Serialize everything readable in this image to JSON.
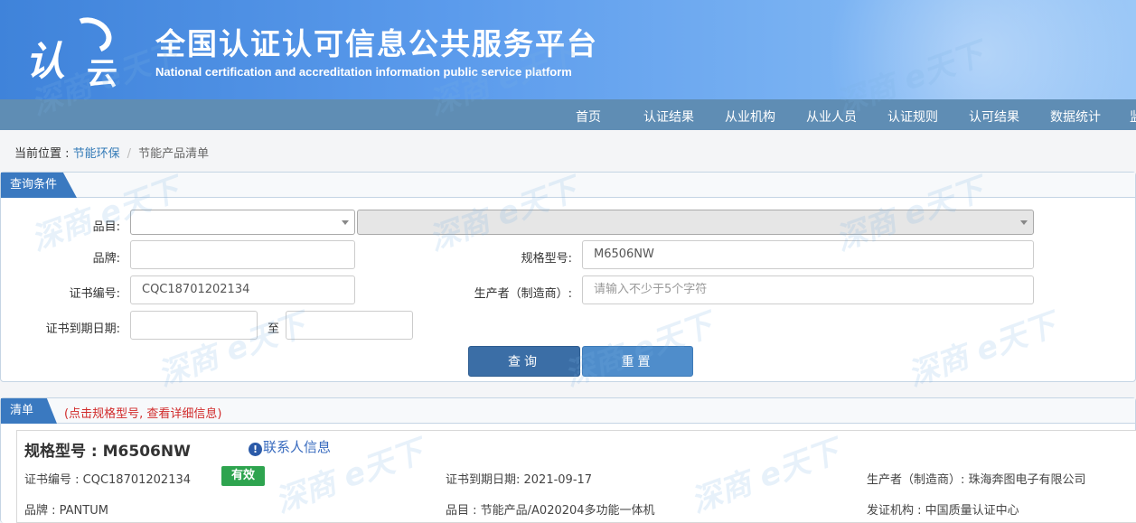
{
  "header": {
    "logo_text_1": "认",
    "logo_text_2": "云",
    "title": "全国认证认可信息公共服务平台",
    "subtitle": "National certification and accreditation information public service platform"
  },
  "nav": {
    "items": [
      "首页",
      "认证结果",
      "从业机构",
      "从业人员",
      "认证规则",
      "认可结果",
      "数据统计",
      "监"
    ]
  },
  "breadcrumb": {
    "prefix": "当前位置 : ",
    "section": "节能环保",
    "separator": "/",
    "current": "节能产品清单"
  },
  "query_panel": {
    "tab": "查询条件",
    "category_label": "品目:",
    "brand_label": "品牌:",
    "brand_value": "",
    "model_label": "规格型号:",
    "model_value": "M6506NW",
    "cert_no_label": "证书编号:",
    "cert_no_value": "CQC18701202134",
    "maker_label": "生产者（制造商）:",
    "maker_placeholder": "请输入不少于5个字符",
    "expiry_label": "证书到期日期:",
    "expiry_to": "至",
    "query_button": "查询",
    "reset_button": "重置"
  },
  "list_panel": {
    "tab": "清单",
    "note": "(点击规格型号, 查看详细信息)"
  },
  "result": {
    "model": "规格型号 : M6506NW",
    "contact_icon": "info-icon",
    "contact": "联系人信息",
    "cert_no": "证书编号 : CQC18701202134",
    "status": "有效",
    "expiry": "证书到期日期: 2021-09-17",
    "maker": "生产者（制造商）: 珠海奔图电子有限公司",
    "brand": "品牌 : PANTUM",
    "category": "品目 : 节能产品/A020204多功能一体机",
    "issuer": "发证机构 : 中国质量认证中心"
  },
  "watermark": "深商 e天下",
  "colors": {
    "nav_bg": "#5f8db4",
    "tab_bg": "#3a79c0",
    "status_green": "#2ea44f",
    "note_red": "#d12b2b"
  }
}
